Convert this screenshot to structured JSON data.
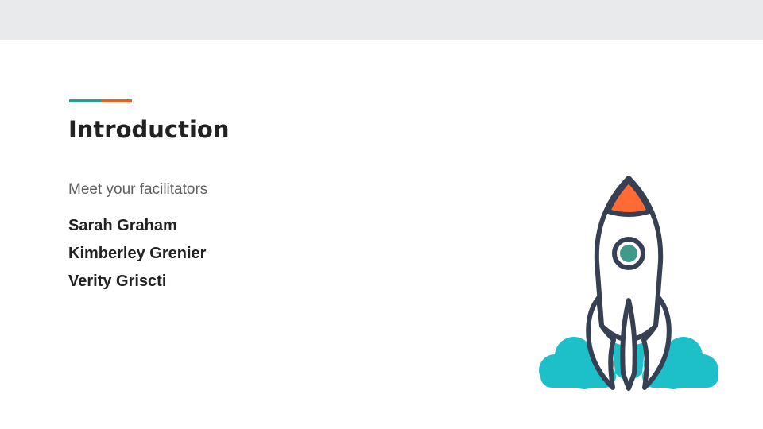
{
  "slide": {
    "title": "Introduction",
    "subtitle": "Meet your facilitators",
    "facilitators": [
      "Sarah Graham",
      "Kimberley Grenier",
      "Verity Griscti"
    ]
  },
  "illustration": {
    "icon": "rocket-launch-icon",
    "colors": {
      "outline": "#364052",
      "nose": "#ff6a35",
      "window": "#3f9a8b",
      "smoke": "#1dbfc8"
    }
  },
  "colors": {
    "accent_teal": "#2a9d8f",
    "accent_orange": "#e4611f",
    "header_band": "#e8eaeb"
  }
}
